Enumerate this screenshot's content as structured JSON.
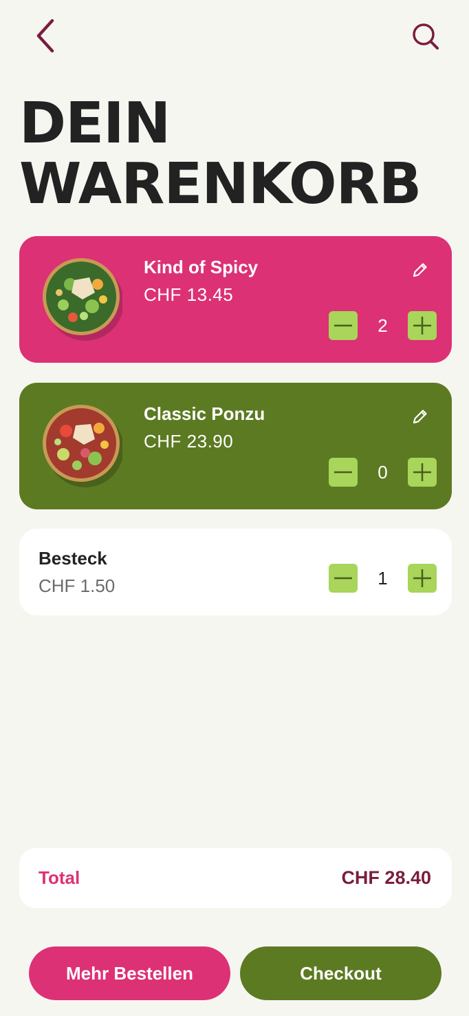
{
  "colors": {
    "background": "#f6f6f1",
    "accent_dark": "#7a1d3f",
    "pink": "#dc3175",
    "green": "#5c7a22",
    "stepper": "#a8d55a"
  },
  "header": {
    "back_icon": "chevron-left-icon",
    "search_icon": "search-icon"
  },
  "title": {
    "line1": "DEIN",
    "line2": "WARENKORB"
  },
  "cart": {
    "items": [
      {
        "name": "Kind of Spicy",
        "price": "CHF  13.45",
        "quantity": "2",
        "color": "#dc3175",
        "image": "poke-bowl-spicy-image"
      },
      {
        "name": "Classic Ponzu",
        "price": "CHF  23.90",
        "quantity": "0",
        "color": "#5c7a22",
        "image": "poke-bowl-ponzu-image"
      }
    ],
    "besteck": {
      "name": "Besteck",
      "price": "CHF 1.50",
      "quantity": "1"
    }
  },
  "summary": {
    "total_label": "Total",
    "total_value": "CHF 28.40"
  },
  "actions": {
    "more_label": "Mehr Bestellen",
    "checkout_label": "Checkout"
  }
}
